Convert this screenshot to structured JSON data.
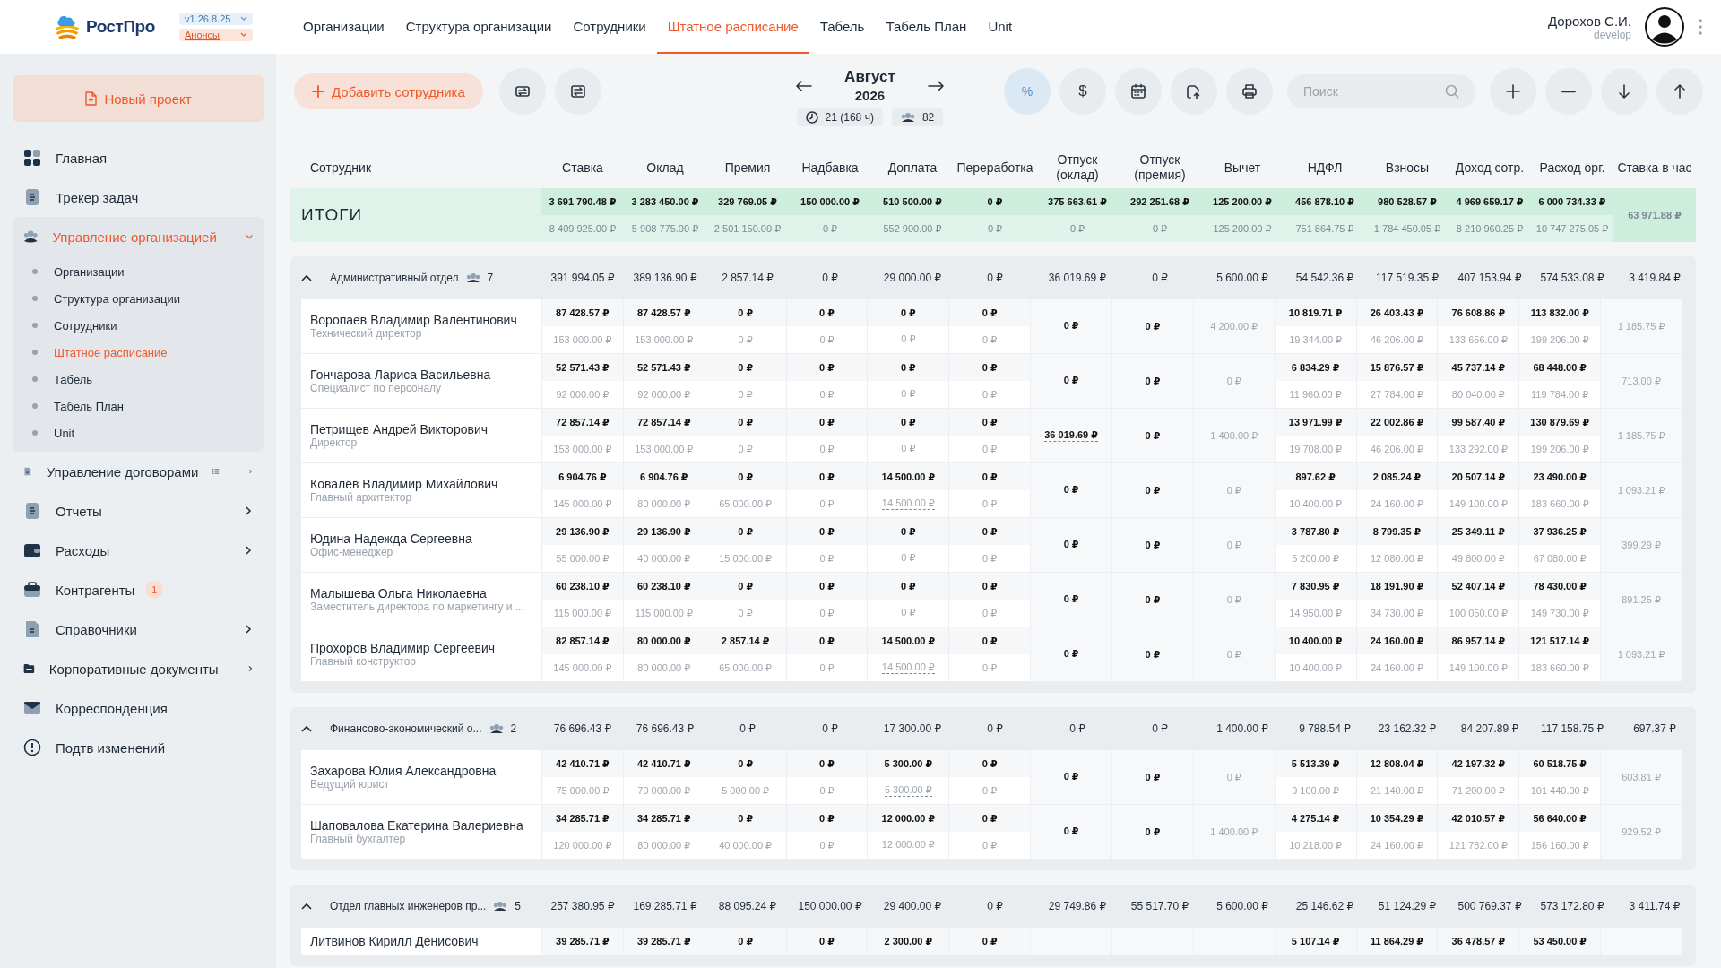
{
  "app": {
    "logo": "РостПро",
    "version": "v1.26.8.25",
    "announcements": "Анонсы"
  },
  "nav_tabs": [
    {
      "label": "Организации",
      "selected": false
    },
    {
      "label": "Структура организации",
      "selected": false
    },
    {
      "label": "Сотрудники",
      "selected": false
    },
    {
      "label": "Штатное расписание",
      "selected": true
    },
    {
      "label": "Табель",
      "selected": false
    },
    {
      "label": "Табель План",
      "selected": false
    },
    {
      "label": "Unit",
      "selected": false
    }
  ],
  "user": {
    "name": "Дорохов С.И.",
    "role": "develop"
  },
  "sidebar": {
    "new_project": "Новый проект",
    "items": [
      {
        "label": "Главная",
        "kind": "link",
        "selected": false
      },
      {
        "label": "Трекер задач",
        "kind": "link",
        "selected": false
      },
      {
        "label": "Управление организацией",
        "kind": "group",
        "selected": true,
        "expanded": true,
        "children": [
          {
            "label": "Организации",
            "selected": false
          },
          {
            "label": "Структура организации",
            "selected": false
          },
          {
            "label": "Сотрудники",
            "selected": false
          },
          {
            "label": "Штатное расписание",
            "selected": true
          },
          {
            "label": "Табель",
            "selected": false
          },
          {
            "label": "Табель План",
            "selected": false
          },
          {
            "label": "Unit",
            "selected": false
          }
        ]
      },
      {
        "label": "Управление договорами",
        "kind": "group",
        "selected": false,
        "expanded": false
      },
      {
        "label": "Отчеты",
        "kind": "group",
        "selected": false,
        "expanded": false
      },
      {
        "label": "Расходы",
        "kind": "group",
        "selected": false,
        "expanded": false
      },
      {
        "label": "Контрагенты",
        "kind": "link",
        "selected": false,
        "badge": "1"
      },
      {
        "label": "Справочники",
        "kind": "group",
        "selected": false,
        "expanded": false
      },
      {
        "label": "Корпоративные документы",
        "kind": "group",
        "selected": false,
        "expanded": false
      },
      {
        "label": "Корреспонденция",
        "kind": "link",
        "selected": false
      },
      {
        "label": "Подтв изменений",
        "kind": "link",
        "selected": false
      }
    ]
  },
  "toolbar": {
    "add_employee": "Добавить сотрудника",
    "month": "Август",
    "year": "2026",
    "working_days": "21 (168 ч)",
    "headcount": "82",
    "view_toggles": [
      {
        "label": "%",
        "selected": true
      },
      {
        "label": "$",
        "selected": false
      }
    ],
    "search": {
      "placeholder": "Поиск"
    }
  },
  "table": {
    "columns": [
      "Сотрудник",
      "Ставка",
      "Оклад",
      "Премия",
      "Надбавка",
      "Доплата",
      "Переработка",
      "Отпуск (оклад)",
      "Отпуск (премия)",
      "Вычет",
      "НДФЛ",
      "Взносы",
      "Доход сотр.",
      "Расход орг.",
      "Ставка в час"
    ],
    "totals": {
      "label": "ИТОГИ",
      "fact": [
        "3 691 790.48 ₽",
        "3 283 450.00 ₽",
        "329 769.05 ₽",
        "150 000.00 ₽",
        "510 500.00 ₽",
        "0 ₽",
        "375 663.61 ₽",
        "292 251.68 ₽",
        "125 200.00 ₽",
        "456 878.10 ₽",
        "980 528.57 ₽",
        "4 969 659.17 ₽",
        "6 000 734.33 ₽"
      ],
      "plan": [
        "8 409 925.00 ₽",
        "5 908 775.00 ₽",
        "2 501 150.00 ₽",
        "0 ₽",
        "552 900.00 ₽",
        "0 ₽",
        "0 ₽",
        "0 ₽",
        "125 200.00 ₽",
        "751 864.75 ₽",
        "1 784 450.05 ₽",
        "8 210 960.25 ₽",
        "10 747 275.05 ₽"
      ],
      "hourly": "63 971.88 ₽"
    },
    "departments": [
      {
        "name": "Административный отдел",
        "count": "7",
        "expanded": true,
        "values": [
          "391 994.05 ₽",
          "389 136.90 ₽",
          "2 857.14 ₽",
          "0 ₽",
          "29 000.00 ₽",
          "0 ₽",
          "36 019.69 ₽",
          "0 ₽",
          "5 600.00 ₽",
          "54 542.36 ₽",
          "117 519.35 ₽",
          "407 153.94 ₽",
          "574 533.08 ₽",
          "3 419.84 ₽"
        ],
        "employees": [
          {
            "name": "Воропаев Владимир Валентинович",
            "position": "Технический директор",
            "fact": [
              "87 428.57 ₽",
              "87 428.57 ₽",
              "0 ₽",
              "0 ₽",
              "0 ₽",
              "0 ₽",
              "10 819.71 ₽",
              "26 403.43 ₽",
              "76 608.86 ₽",
              "113 832.00 ₽"
            ],
            "plan": [
              "153 000.00 ₽",
              "153 000.00 ₽",
              "0 ₽",
              "0 ₽",
              "0 ₽",
              "0 ₽",
              "19 344.00 ₽",
              "46 206.00 ₽",
              "133 656.00 ₽",
              "199 206.00 ₽"
            ],
            "vacation_salary": "0 ₽",
            "vacation_bonus": "0 ₽",
            "deduction": "4 200.00 ₽",
            "hourly": "1 185.75 ₽",
            "allowance_link": false,
            "vacation_link": false
          },
          {
            "name": "Гончарова Лариса Васильевна",
            "position": "Специалист по персоналу",
            "fact": [
              "52 571.43 ₽",
              "52 571.43 ₽",
              "0 ₽",
              "0 ₽",
              "0 ₽",
              "0 ₽",
              "6 834.29 ₽",
              "15 876.57 ₽",
              "45 737.14 ₽",
              "68 448.00 ₽"
            ],
            "plan": [
              "92 000.00 ₽",
              "92 000.00 ₽",
              "0 ₽",
              "0 ₽",
              "0 ₽",
              "0 ₽",
              "11 960.00 ₽",
              "27 784.00 ₽",
              "80 040.00 ₽",
              "119 784.00 ₽"
            ],
            "vacation_salary": "0 ₽",
            "vacation_bonus": "0 ₽",
            "deduction": "0 ₽",
            "hourly": "713.00 ₽",
            "allowance_link": false,
            "vacation_link": false
          },
          {
            "name": "Петрищев Андрей Викторович",
            "position": "Директор",
            "fact": [
              "72 857.14 ₽",
              "72 857.14 ₽",
              "0 ₽",
              "0 ₽",
              "0 ₽",
              "0 ₽",
              "13 971.99 ₽",
              "22 002.86 ₽",
              "99 587.40 ₽",
              "130 879.69 ₽"
            ],
            "plan": [
              "153 000.00 ₽",
              "153 000.00 ₽",
              "0 ₽",
              "0 ₽",
              "0 ₽",
              "0 ₽",
              "19 708.00 ₽",
              "46 206.00 ₽",
              "133 292.00 ₽",
              "199 206.00 ₽"
            ],
            "vacation_salary": "36 019.69 ₽",
            "vacation_bonus": "0 ₽",
            "deduction": "1 400.00 ₽",
            "hourly": "1 185.75 ₽",
            "allowance_link": false,
            "vacation_link": true
          },
          {
            "name": "Ковалёв Владимир Михайлович",
            "position": "Главный архитектор",
            "fact": [
              "6 904.76 ₽",
              "6 904.76 ₽",
              "0 ₽",
              "0 ₽",
              "14 500.00 ₽",
              "0 ₽",
              "897.62 ₽",
              "2 085.24 ₽",
              "20 507.14 ₽",
              "23 490.00 ₽"
            ],
            "plan": [
              "145 000.00 ₽",
              "80 000.00 ₽",
              "65 000.00 ₽",
              "0 ₽",
              "14 500.00 ₽",
              "0 ₽",
              "10 400.00 ₽",
              "24 160.00 ₽",
              "149 100.00 ₽",
              "183 660.00 ₽"
            ],
            "vacation_salary": "0 ₽",
            "vacation_bonus": "0 ₽",
            "deduction": "0 ₽",
            "hourly": "1 093.21 ₽",
            "allowance_link": true,
            "vacation_link": false
          },
          {
            "name": "Юдина Надежда Сергеевна",
            "position": "Офис-менеджер",
            "fact": [
              "29 136.90 ₽",
              "29 136.90 ₽",
              "0 ₽",
              "0 ₽",
              "0 ₽",
              "0 ₽",
              "3 787.80 ₽",
              "8 799.35 ₽",
              "25 349.11 ₽",
              "37 936.25 ₽"
            ],
            "plan": [
              "55 000.00 ₽",
              "40 000.00 ₽",
              "15 000.00 ₽",
              "0 ₽",
              "0 ₽",
              "0 ₽",
              "5 200.00 ₽",
              "12 080.00 ₽",
              "49 800.00 ₽",
              "67 080.00 ₽"
            ],
            "vacation_salary": "0 ₽",
            "vacation_bonus": "0 ₽",
            "deduction": "0 ₽",
            "hourly": "399.29 ₽",
            "allowance_link": false,
            "vacation_link": false
          },
          {
            "name": "Малышева Ольга Николаевна",
            "position": "Заместитель директора по маркетингу и ...",
            "fact": [
              "60 238.10 ₽",
              "60 238.10 ₽",
              "0 ₽",
              "0 ₽",
              "0 ₽",
              "0 ₽",
              "7 830.95 ₽",
              "18 191.90 ₽",
              "52 407.14 ₽",
              "78 430.00 ₽"
            ],
            "plan": [
              "115 000.00 ₽",
              "115 000.00 ₽",
              "0 ₽",
              "0 ₽",
              "0 ₽",
              "0 ₽",
              "14 950.00 ₽",
              "34 730.00 ₽",
              "100 050.00 ₽",
              "149 730.00 ₽"
            ],
            "vacation_salary": "0 ₽",
            "vacation_bonus": "0 ₽",
            "deduction": "0 ₽",
            "hourly": "891.25 ₽",
            "allowance_link": false,
            "vacation_link": false
          },
          {
            "name": "Прохоров Владимир Сергеевич",
            "position": "Главный конструктор",
            "fact": [
              "82 857.14 ₽",
              "80 000.00 ₽",
              "2 857.14 ₽",
              "0 ₽",
              "14 500.00 ₽",
              "0 ₽",
              "10 400.00 ₽",
              "24 160.00 ₽",
              "86 957.14 ₽",
              "121 517.14 ₽"
            ],
            "plan": [
              "145 000.00 ₽",
              "80 000.00 ₽",
              "65 000.00 ₽",
              "0 ₽",
              "14 500.00 ₽",
              "0 ₽",
              "10 400.00 ₽",
              "24 160.00 ₽",
              "149 100.00 ₽",
              "183 660.00 ₽"
            ],
            "vacation_salary": "0 ₽",
            "vacation_bonus": "0 ₽",
            "deduction": "0 ₽",
            "hourly": "1 093.21 ₽",
            "allowance_link": true,
            "vacation_link": false
          }
        ]
      },
      {
        "name": "Финансово-экономический о...",
        "count": "2",
        "expanded": true,
        "values": [
          "76 696.43 ₽",
          "76 696.43 ₽",
          "0 ₽",
          "0 ₽",
          "17 300.00 ₽",
          "0 ₽",
          "0 ₽",
          "0 ₽",
          "1 400.00 ₽",
          "9 788.54 ₽",
          "23 162.32 ₽",
          "84 207.89 ₽",
          "117 158.75 ₽",
          "697.37 ₽"
        ],
        "employees": [
          {
            "name": "Захарова Юлия Александровна",
            "position": "Ведущий юрист",
            "fact": [
              "42 410.71 ₽",
              "42 410.71 ₽",
              "0 ₽",
              "0 ₽",
              "5 300.00 ₽",
              "0 ₽",
              "5 513.39 ₽",
              "12 808.04 ₽",
              "42 197.32 ₽",
              "60 518.75 ₽"
            ],
            "plan": [
              "75 000.00 ₽",
              "70 000.00 ₽",
              "5 000.00 ₽",
              "0 ₽",
              "5 300.00 ₽",
              "0 ₽",
              "9 100.00 ₽",
              "21 140.00 ₽",
              "71 200.00 ₽",
              "101 440.00 ₽"
            ],
            "vacation_salary": "0 ₽",
            "vacation_bonus": "0 ₽",
            "deduction": "0 ₽",
            "hourly": "603.81 ₽",
            "allowance_link": true,
            "vacation_link": false
          },
          {
            "name": "Шаповалова Екатерина Валериевна",
            "position": "Главный бухгалтер",
            "fact": [
              "34 285.71 ₽",
              "34 285.71 ₽",
              "0 ₽",
              "0 ₽",
              "12 000.00 ₽",
              "0 ₽",
              "4 275.14 ₽",
              "10 354.29 ₽",
              "42 010.57 ₽",
              "56 640.00 ₽"
            ],
            "plan": [
              "120 000.00 ₽",
              "80 000.00 ₽",
              "40 000.00 ₽",
              "0 ₽",
              "12 000.00 ₽",
              "0 ₽",
              "10 218.00 ₽",
              "24 160.00 ₽",
              "121 782.00 ₽",
              "156 160.00 ₽"
            ],
            "vacation_salary": "0 ₽",
            "vacation_bonus": "0 ₽",
            "deduction": "1 400.00 ₽",
            "hourly": "929.52 ₽",
            "allowance_link": true,
            "vacation_link": false
          }
        ]
      },
      {
        "name": "Отдел главных инженеров пр...",
        "count": "5",
        "expanded": true,
        "values": [
          "257 380.95 ₽",
          "169 285.71 ₽",
          "88 095.24 ₽",
          "150 000.00 ₽",
          "29 400.00 ₽",
          "0 ₽",
          "29 749.86 ₽",
          "55 517.70 ₽",
          "5 600.00 ₽",
          "25 146.62 ₽",
          "51 124.29 ₽",
          "500 769.37 ₽",
          "573 172.80 ₽",
          "3 411.74 ₽"
        ],
        "employees": [
          {
            "name": "Литвинов Кирилл Денисович",
            "fact": [
              "39 285.71 ₽",
              "39 285.71 ₽",
              "0 ₽",
              "0 ₽",
              "2 300.00 ₽",
              "0 ₽",
              "5 107.14 ₽",
              "11 864.29 ₽",
              "36 478.57 ₽",
              "53 450.00 ₽"
            ]
          }
        ]
      }
    ]
  }
}
